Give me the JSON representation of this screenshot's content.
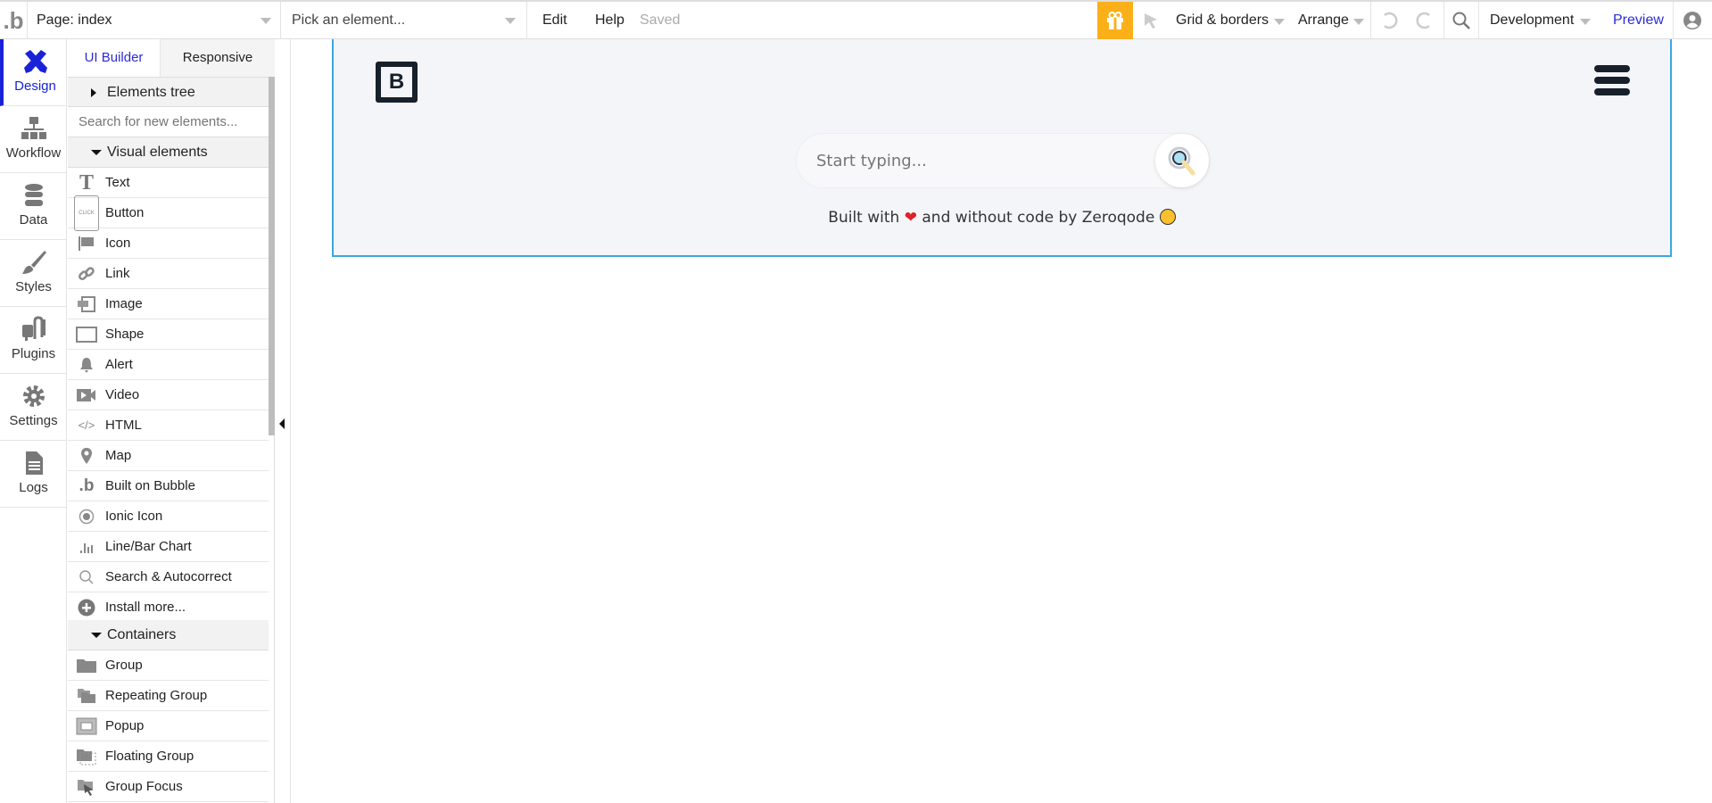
{
  "topbar": {
    "page_label": "Page: index",
    "element_placeholder": "Pick an element...",
    "edit": "Edit",
    "help": "Help",
    "saved": "Saved",
    "grid": "Grid & borders",
    "arrange": "Arrange",
    "environment": "Development",
    "preview": "Preview",
    "accent": "#fbb01a"
  },
  "nav": [
    {
      "label": "Design"
    },
    {
      "label": "Workflow"
    },
    {
      "label": "Data"
    },
    {
      "label": "Styles"
    },
    {
      "label": "Plugins"
    },
    {
      "label": "Settings"
    },
    {
      "label": "Logs"
    }
  ],
  "panel": {
    "tabs": [
      "UI Builder",
      "Responsive"
    ],
    "elements_tree": "Elements tree",
    "search_placeholder": "Search for new elements...",
    "visual_header": "Visual elements",
    "visual": [
      "Text",
      "Button",
      "Icon",
      "Link",
      "Image",
      "Shape",
      "Alert",
      "Video",
      "HTML",
      "Map",
      "Built on Bubble",
      "Ionic Icon",
      "Line/Bar Chart",
      "Search & Autocorrect",
      "Install more..."
    ],
    "containers_header": "Containers",
    "containers": [
      "Group",
      "Repeating Group",
      "Popup",
      "Floating Group",
      "Group Focus"
    ],
    "button_icon_text": "CLICK"
  },
  "canvas": {
    "logo_letter": "B",
    "search_placeholder": "Start typing...",
    "footer_a": "Built with",
    "footer_b": "and without code by Zeroqode"
  }
}
